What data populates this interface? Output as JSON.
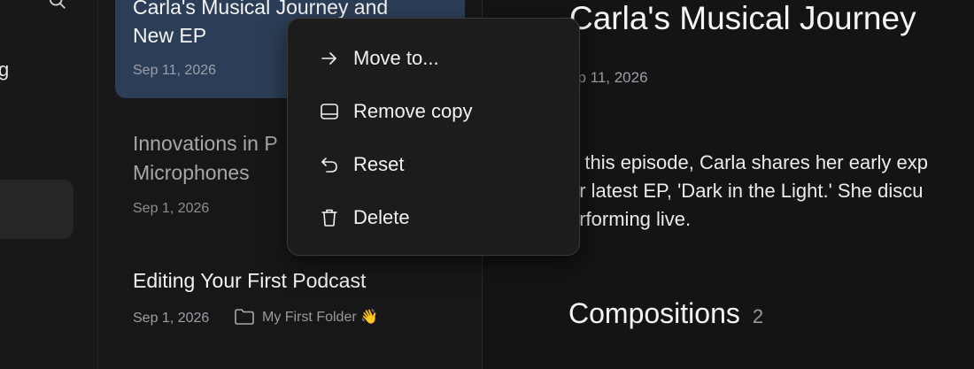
{
  "sidebar": {
    "search_icon": "search-icon",
    "visible_fragment": "g"
  },
  "episodes": [
    {
      "title_line1": "Carla's Musical Journey and",
      "title_line2": "New EP",
      "date": "Sep 11, 2026",
      "selected": true
    },
    {
      "title_line1": "Innovations in P",
      "title_line2": "Microphones",
      "date": "Sep 1, 2026",
      "selected": false
    },
    {
      "title": "Editing Your First Podcast",
      "date": "Sep 1, 2026",
      "folder": "My First Folder 👋",
      "folder_icon": "folder-icon",
      "selected": false
    }
  ],
  "context_menu": {
    "items": [
      {
        "label": "Move to...",
        "icon": "arrow-right-icon"
      },
      {
        "label": "Remove copy",
        "icon": "inbox-tray-icon"
      },
      {
        "label": "Reset",
        "icon": "undo-icon"
      },
      {
        "label": "Delete",
        "icon": "trash-icon"
      }
    ]
  },
  "detail": {
    "title": "Carla's Musical Journey",
    "date": "ep 11, 2026",
    "body_lines": [
      "n this episode, Carla shares her early exp",
      "er latest EP, 'Dark in the Light.' She discu",
      "erforming live."
    ],
    "compositions_heading": "Compositions",
    "compositions_count": "2"
  },
  "colors": {
    "active_card": "#2c3e57",
    "background": "#151515",
    "menu_background": "#1c1c1c"
  }
}
